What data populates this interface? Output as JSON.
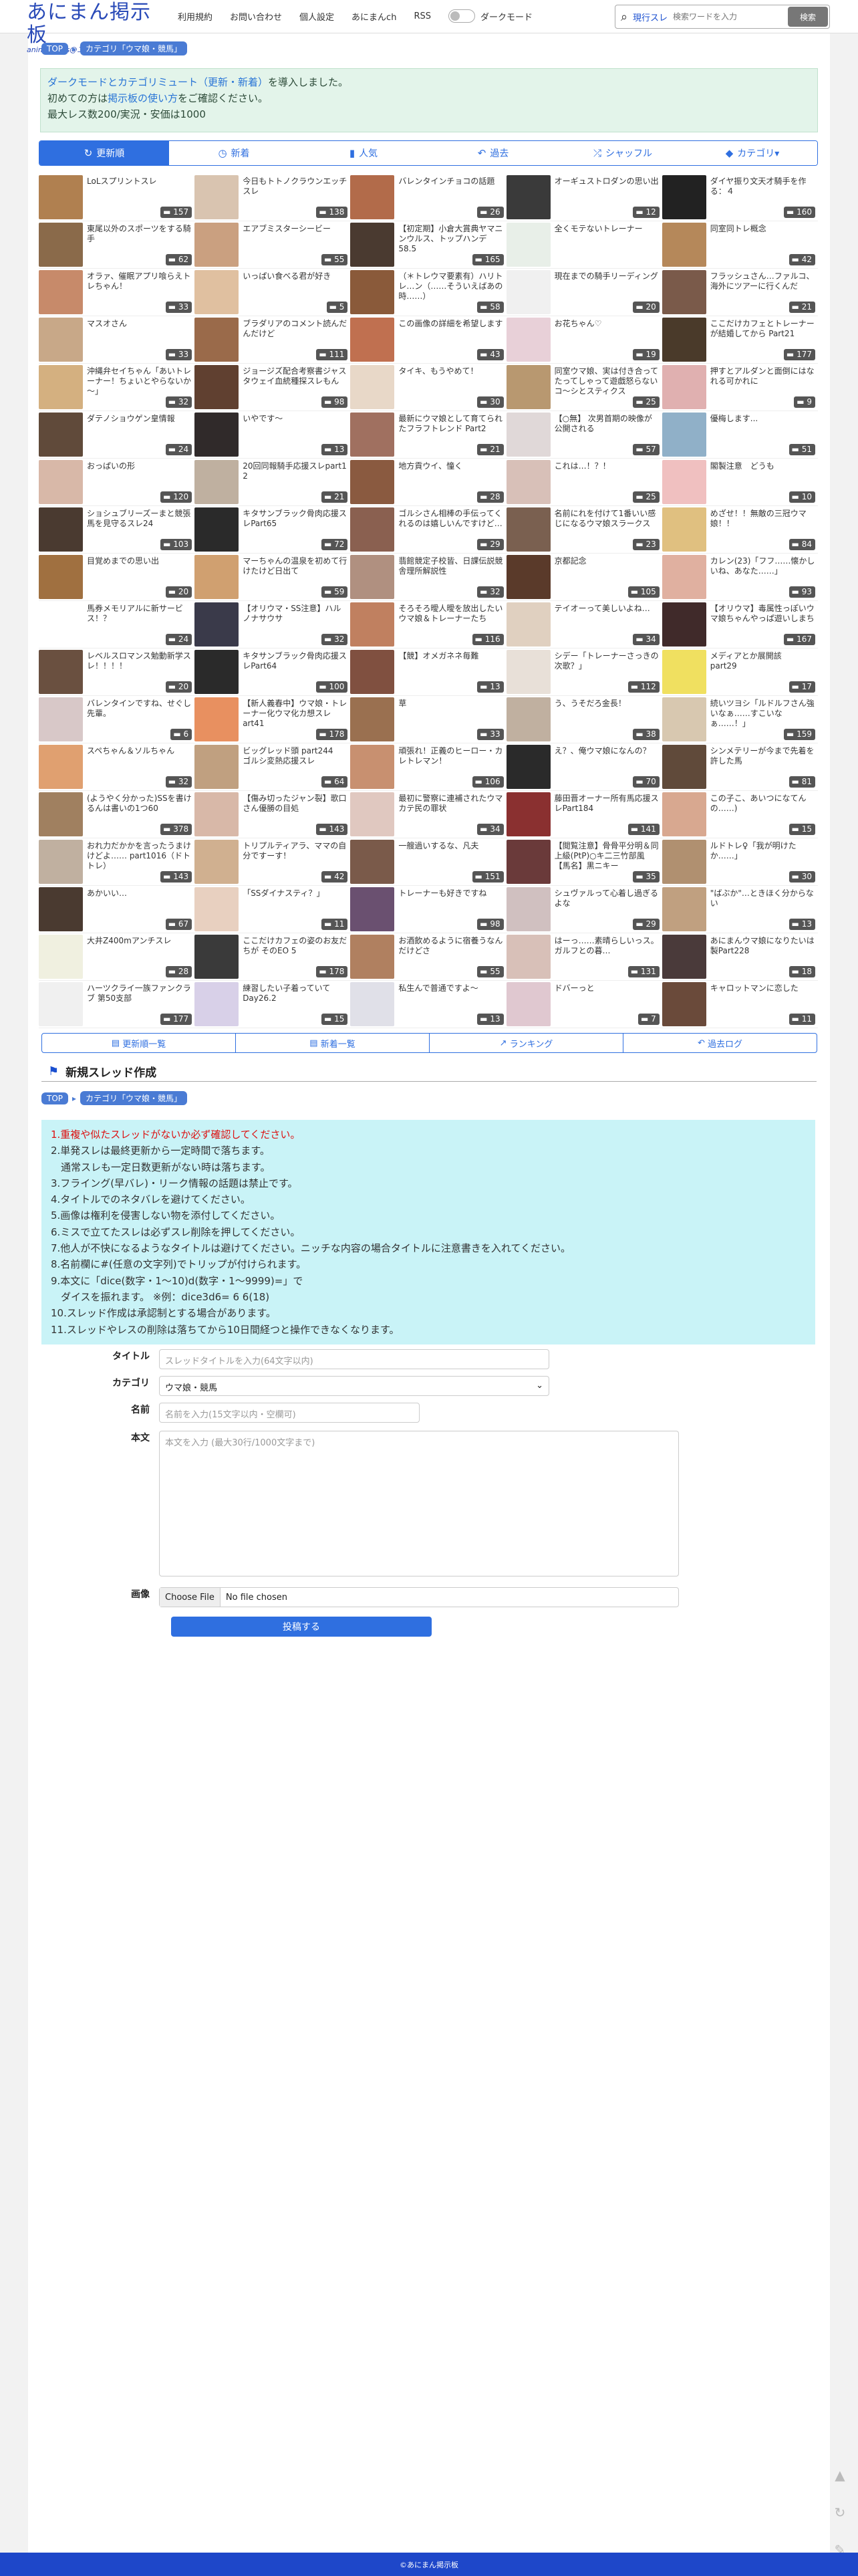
{
  "header": {
    "logo_main": "あにまん掲示板",
    "logo_sub": "animan bbs@二次元オンリー",
    "nav": [
      "利用規約",
      "お問い合わせ",
      "個人設定",
      "あにまんch",
      "RSS"
    ],
    "dark_mode_label": "ダークモード",
    "search_kind": "現行スレ",
    "search_placeholder": "検索ワードを入力",
    "search_button": "検索"
  },
  "breadcrumb": {
    "top": "TOP",
    "category": "カテゴリ「ウマ娘・競馬」"
  },
  "notice": {
    "line1_link": "ダークモードとカテゴリミュート（更新・新着）",
    "line1_rest": "を導入しました。",
    "line2_pre": "初めての方は",
    "line2_link": "掲示板の使い方",
    "line2_post": "をご確認ください。",
    "line3": "最大レス数200/実況・安価は1000"
  },
  "tabs": [
    {
      "icon": "↻",
      "label": "更新順"
    },
    {
      "icon": "◷",
      "label": "新着"
    },
    {
      "icon": "▮",
      "label": "人気"
    },
    {
      "icon": "↶",
      "label": "過去"
    },
    {
      "icon": "⤮",
      "label": "シャッフル"
    },
    {
      "icon": "◆",
      "label": "カテゴリ▾"
    }
  ],
  "threads": [
    {
      "t": "LoLスプリントスレ",
      "c": "157",
      "col": "#b08050"
    },
    {
      "t": "今日もトトノクラウンエッチスレ",
      "c": "138",
      "col": "#d9c4b0"
    },
    {
      "t": "バレンタインチョコの話題",
      "c": "26",
      "col": "#b26b4a"
    },
    {
      "t": "オーギュストロダンの思い出",
      "c": "12",
      "col": "#3a3a3a"
    },
    {
      "t": "ダイヤ振り文天才騎手を作る：４",
      "c": "160",
      "col": "#222222"
    },
    {
      "t": "東尾以外のスポーツをする騎手",
      "c": "62",
      "col": "#8a6a4a"
    },
    {
      "t": "エアブミスターシービー",
      "c": "55",
      "col": "#caa080"
    },
    {
      "t": "【初定期】小倉大賞典ヤマニンウルス、トップハンデ58.5",
      "c": "165",
      "col": "#4a3a30"
    },
    {
      "t": "全くモテないトレーナー",
      "c": "",
      "col": "#e8efe8"
    },
    {
      "t": "同室同トレ概念",
      "c": "42",
      "col": "#b5885a"
    },
    {
      "t": "オラァ、催眠アプリ喰らえトレちゃん！",
      "c": "33",
      "col": "#c78a6a"
    },
    {
      "t": "いっぱい食べる君が好き",
      "c": "5",
      "col": "#e0c0a0"
    },
    {
      "t": "（＊トレウマ要素有）ハリトレ…ン（……そういえばあの時……）",
      "c": "58",
      "col": "#8a5a3a"
    },
    {
      "t": "現在までの騎手リーディング",
      "c": "20",
      "col": "#f0f0f0"
    },
    {
      "t": "フラッシュさん…ファルコ、海外にツアーに行くんだ",
      "c": "21",
      "col": "#7a5a4a"
    },
    {
      "t": "マスオさん",
      "c": "33",
      "col": "#c8a888"
    },
    {
      "t": "ブラダリアのコメント読んだんだけど",
      "c": "111",
      "col": "#9a6a4a"
    },
    {
      "t": "この画像の詳細を希望します",
      "c": "43",
      "col": "#c07050"
    },
    {
      "t": "お花ちゃん♡",
      "c": "19",
      "col": "#e8d0d8"
    },
    {
      "t": "ここだけカフェとトレーナーが結婚してから Part21",
      "c": "177",
      "col": "#4a3a2a"
    },
    {
      "t": "沖縄弁セイちゃん「あいトレーナー！ちょいとやらないか～」",
      "c": "32",
      "col": "#d4b080"
    },
    {
      "t": "ジョージズ配合考察書ジャスタウェイ血統種探スレもん",
      "c": "98",
      "col": "#604030"
    },
    {
      "t": "タイキ、もうやめて！",
      "c": "30",
      "col": "#e8d8c8"
    },
    {
      "t": "同室ウマ娘、実は付き合ってたってしゃって遊戯怒らないコ〜シとスティクス",
      "c": "25",
      "col": "#b89870"
    },
    {
      "t": "押すとアルダンと面倒にはなれる可かれに",
      "c": "9",
      "col": "#e0b0b0"
    },
    {
      "t": "ダテノショウゲン皇情報",
      "c": "24",
      "col": "#604a3a"
    },
    {
      "t": "いやです〜",
      "c": "13",
      "col": "#302a2a"
    },
    {
      "t": "最新にウマ娘として育てられたフラフトレンド Part2",
      "c": "21",
      "col": "#a07060"
    },
    {
      "t": "【○無】 次男首期の映像が公開される",
      "c": "57",
      "col": "#e0d8d8"
    },
    {
      "t": "優梅します...",
      "c": "51",
      "col": "#90b0c8"
    },
    {
      "t": "おっぱいの形",
      "c": "120",
      "col": "#d8b8a8"
    },
    {
      "t": "20回同報騎手応援スレpart1 2",
      "c": "21",
      "col": "#bfb0a0"
    },
    {
      "t": "地方貢ウイ、憧く",
      "c": "28",
      "col": "#8a5a40"
    },
    {
      "t": "これは…！？！",
      "c": "25",
      "col": "#d8c0b8"
    },
    {
      "t": "閣製注意　どうも",
      "c": "10",
      "col": "#f0c0c0"
    },
    {
      "t": "ショシュブリーズーまと競張馬を見守るスレ24",
      "c": "103",
      "col": "#4a3a30"
    },
    {
      "t": "キタサンブラック骨肉応援スレPart65",
      "c": "72",
      "col": "#2a2a2a"
    },
    {
      "t": "ゴルシさん相棒の手伝ってくれるのは嬉しいんですけど…",
      "c": "29",
      "col": "#8a6050"
    },
    {
      "t": "名前にれを付けて1番いい感じになるウマ娘スラークス",
      "c": "23",
      "col": "#7a6050"
    },
    {
      "t": "めざせ！！無敵の三冠ウマ娘！！",
      "c": "84",
      "col": "#e0c080"
    },
    {
      "t": "目覚めまでの思い出",
      "c": "20",
      "col": "#a07040"
    },
    {
      "t": "マーちゃんの温泉を初めて行けたけど日出て",
      "c": "59",
      "col": "#d0a070"
    },
    {
      "t": "翡館競定子校皆、日課伝説競舎理所解説性",
      "c": "32",
      "col": "#b09080"
    },
    {
      "t": "京都記念",
      "c": "105",
      "col": "#5a3a2a"
    },
    {
      "t": "カレン(23)「フフ……懐かしいね、あなた……」",
      "c": "93",
      "col": "#e0b0a0"
    },
    {
      "t": "馬券メモリアルに新サービス！？",
      "c": "24",
      "col": "#ffffff"
    },
    {
      "t": "【オリウマ・SS注意】ハルノナサウサ",
      "c": "32",
      "col": "#3a3a4a"
    },
    {
      "t": "そろそろ曖人曖を放出したいウマ娘＆トレーナーたち",
      "c": "116",
      "col": "#c08060"
    },
    {
      "t": "テイオーって美しいよね…",
      "c": "34",
      "col": "#e0d0c0"
    },
    {
      "t": "【オリウマ】毒属性っぽいウマ娘ちゃんやっぱ遊いしまち",
      "c": "167",
      "col": "#402a2a"
    },
    {
      "t": "レベルスロマンス勉動新学スレ！！！！",
      "c": "20",
      "col": "#6a5040"
    },
    {
      "t": "キタサンブラック骨肉応援スレPart64",
      "c": "100",
      "col": "#2a2a2a"
    },
    {
      "t": "【競】オメガネネ毎難",
      "c": "13",
      "col": "#805040"
    },
    {
      "t": "シデー「トレーナーさっきの次歌？」",
      "c": "112",
      "col": "#e8e0d8"
    },
    {
      "t": "メディアとか展開該　part29",
      "c": "17",
      "col": "#f0e060"
    },
    {
      "t": "バレンタインですね、せぐし先輩。",
      "c": "6",
      "col": "#d8c8c8"
    },
    {
      "t": "【新人義春中】ウマ娘・トレーナー化ウマ化カ想スレart41",
      "c": "178",
      "col": "#e89060"
    },
    {
      "t": "草",
      "c": "33",
      "col": "#9a7050"
    },
    {
      "t": "う、うそだろ金長！",
      "c": "38",
      "col": "#c0b0a0"
    },
    {
      "t": "続いツヨシ「ルドルフさん強いなぁ……すこいなぁ……！」",
      "c": "159",
      "col": "#d8c8b0"
    },
    {
      "t": "スペちゃん＆ソルちゃん",
      "c": "32",
      "col": "#e0a070"
    },
    {
      "t": "ビッグレッド頭 part244　ゴルシ変熱応援スレ",
      "c": "64",
      "col": "#c0a080"
    },
    {
      "t": "頑張れ！正義のヒーロー・カレトレマン！",
      "c": "106",
      "col": "#c89070"
    },
    {
      "t": "え？、俺ウマ娘になんの？",
      "c": "70",
      "col": "#2a2a2a"
    },
    {
      "t": "シンメテリーが今まで先着を許した馬",
      "c": "81",
      "col": "#604a3a"
    },
    {
      "t": "(ようやく分かった)SSを書けるんは書いの1つ60",
      "c": "378",
      "col": "#a08060"
    },
    {
      "t": "【傷み切ったジャン裂】歌口さん優勝の目処",
      "c": "143",
      "col": "#d8b8a8"
    },
    {
      "t": "最初に警察に連補されたウマカテ民の罪状",
      "c": "34",
      "col": "#e0c8c0"
    },
    {
      "t": "藤田晋オーナー所有馬応援スレPart184",
      "c": "141",
      "col": "#8a3030"
    },
    {
      "t": "この子こ、あいつになてんの……)",
      "c": "15",
      "col": "#d8a890"
    },
    {
      "t": "おれ力だかかを言ったうまけけどよ…… part1016（ドトトレ）",
      "c": "143",
      "col": "#c0b0a0"
    },
    {
      "t": "トリプルティアラ、ママの自分ですーす！",
      "c": "42",
      "col": "#d0b090"
    },
    {
      "t": "一艘過いするな、凡夫",
      "c": "151",
      "col": "#7a5a4a"
    },
    {
      "t": "【閲覧注意】骨骨平分明＆同上級(PtP)○キ二三竹部風【馬名】黒ニキー",
      "c": "35",
      "col": "#6a3a3a"
    },
    {
      "t": "ルドトレ♀「我が明けたか……」",
      "c": "30",
      "col": "#b09070"
    },
    {
      "t": "あかいい…",
      "c": "67",
      "col": "#4a3a30"
    },
    {
      "t": "「SSダイナスティ？」",
      "c": "11",
      "col": "#e8d0c0"
    },
    {
      "t": "トレーナーも好きですね",
      "c": "98",
      "col": "#6a5070"
    },
    {
      "t": "シュヴァルって心着し過ぎるよな",
      "c": "29",
      "col": "#d0c0c0"
    },
    {
      "t": "\"ばぶか\"…ときほく分からない",
      "c": "13",
      "col": "#c0a080"
    },
    {
      "t": "大井Z400mアンチスレ",
      "c": "28",
      "col": "#f0f0e0"
    },
    {
      "t": "ここだけカフェの姿のお友だちが そのEO 5",
      "c": "178",
      "col": "#3a3a3a"
    },
    {
      "t": "お酒飲めるように宿養うなんだけどさ",
      "c": "55",
      "col": "#b08060"
    },
    {
      "t": "はーっ……素晴らしいっス。ガルフとの暮…",
      "c": "131",
      "col": "#d8c0b8"
    },
    {
      "t": "あにまんウマ娘になりたいは製Part228",
      "c": "18",
      "col": "#4a3a3a"
    },
    {
      "t": "ハーツクライ一族ファンクラブ 第50支部",
      "c": "177",
      "col": "#f0f0f0"
    },
    {
      "t": "練習したい子着っていて Day26.2",
      "c": "15",
      "col": "#d8d0e8"
    },
    {
      "t": "私生んで普通ですよ〜",
      "c": "13",
      "col": "#e0e0e8"
    },
    {
      "t": "ドバーっと",
      "c": "7",
      "col": "#e0c8d0"
    },
    {
      "t": "キャロットマンに恋した",
      "c": "11",
      "col": "#6a4a3a"
    }
  ],
  "subnav": [
    "更新順一覧",
    "新着一覧",
    "ランキング",
    "過去ログ"
  ],
  "new_thread": {
    "heading": "新規スレッド作成",
    "rules": [
      "1.重複や似たスレッドがないか必ず確認してください。",
      "2.単発スレは最終更新から一定時間で落ちます。",
      "　通常スレも一定日数更新がない時は落ちます。",
      "3.フライング(早バレ)・リーク情報の話題は禁止です。",
      "4.タイトルでのネタバレを避けてください。",
      "5.画像は権利を侵害しない物を添付してください。",
      "6.ミスで立てたスレは必ずスレ削除を押してください。",
      "7.他人が不快になるようなタイトルは避けてください。ニッチな内容の場合タイトルに注意書きを入れてください。",
      "8.名前欄に#(任意の文字列)でトリップが付けられます。",
      "9.本文に「dice(数字・1〜10)d(数字・1〜9999)=」で",
      "　ダイスを振れます。 ※例：dice3d6= 6 6(18)",
      "10.スレッド作成は承認制とする場合があります。",
      "11.スレッドやレスの削除は落ちてから10日間経つと操作できなくなります。"
    ],
    "labels": {
      "title": "タイトル",
      "category": "カテゴリ",
      "name": "名前",
      "body": "本文",
      "image": "画像"
    },
    "placeholders": {
      "title": "スレッドタイトルを入力(64文字以内)",
      "name": "名前を入力(15文字以内・空欄可)",
      "body": "本文を入力 (最大30行/1000文字まで)"
    },
    "category_value": "ウマ娘・競馬",
    "file_button": "Choose File",
    "file_status": "No file chosen",
    "submit": "投稿する"
  },
  "footer": "©あにまん掲示板"
}
